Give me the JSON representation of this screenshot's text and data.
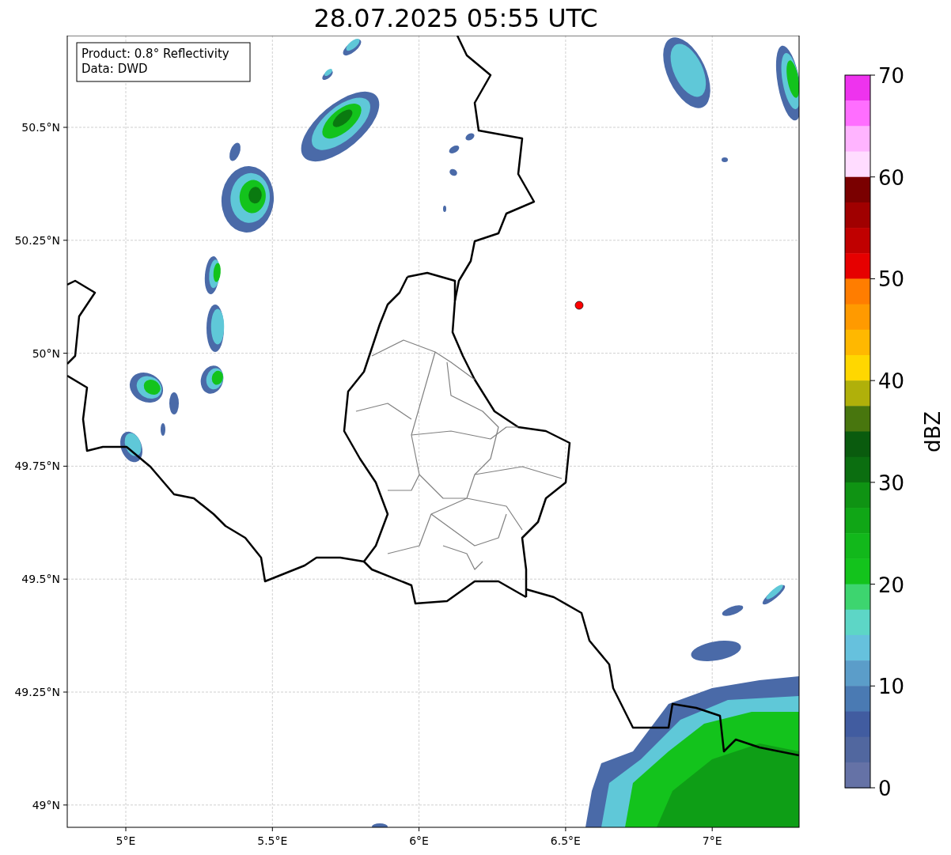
{
  "title": "28.07.2025 05:55 UTC",
  "info_box": {
    "lines": [
      "Product: 0.8° Reflectivity",
      "Data: DWD"
    ]
  },
  "map": {
    "x_ticks": [
      "5°E",
      "5.5°E",
      "6°E",
      "6.5°E",
      "7°E"
    ],
    "y_ticks": [
      "50.5°N",
      "50.25°N",
      "50°N",
      "49.75°N",
      "49.5°N",
      "49.25°N",
      "49°N"
    ]
  },
  "colorbar": {
    "label": "dBZ",
    "ticks": [
      "70",
      "60",
      "50",
      "40",
      "30",
      "20",
      "10",
      "0"
    ],
    "segments": [
      {
        "color": "#ee33ee"
      },
      {
        "color": "#ff6eff"
      },
      {
        "color": "#ffb4ff"
      },
      {
        "color": "#ffdcff"
      },
      {
        "color": "#7a0000"
      },
      {
        "color": "#a00000"
      },
      {
        "color": "#c00000"
      },
      {
        "color": "#e60000"
      },
      {
        "color": "#ff7d00"
      },
      {
        "color": "#ff9a00"
      },
      {
        "color": "#ffb800"
      },
      {
        "color": "#ffd700"
      },
      {
        "color": "#b0b00a"
      },
      {
        "color": "#48760e"
      },
      {
        "color": "#0a5b0e"
      },
      {
        "color": "#0b6e10"
      },
      {
        "color": "#0f9313"
      },
      {
        "color": "#10a616"
      },
      {
        "color": "#12b81b"
      },
      {
        "color": "#13c31c"
      },
      {
        "color": "#3dd56f"
      },
      {
        "color": "#5dd6c6"
      },
      {
        "color": "#66c1dd"
      },
      {
        "color": "#5b9dc9"
      },
      {
        "color": "#4a7ab3"
      },
      {
        "color": "#415ca0"
      },
      {
        "color": "#51679f"
      },
      {
        "color": "#6572a6"
      }
    ]
  }
}
